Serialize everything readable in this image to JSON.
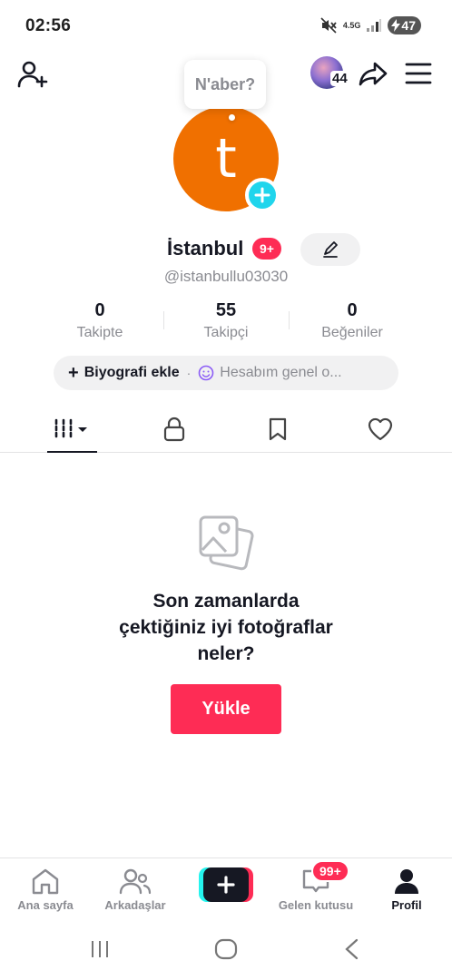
{
  "status_bar": {
    "time": "02:56",
    "network": "4.5G",
    "battery": "47"
  },
  "top_bar": {
    "visitor_count": "44"
  },
  "bubble": {
    "text": "N'aber?"
  },
  "avatar": {
    "letter": "t",
    "color": "#f07000"
  },
  "profile": {
    "name": "İstanbul",
    "badge": "9+",
    "handle": "@istanbullu03030"
  },
  "stats": [
    {
      "value": "0",
      "label": "Takipte"
    },
    {
      "value": "55",
      "label": "Takipçi"
    },
    {
      "value": "0",
      "label": "Beğeniler"
    }
  ],
  "bio": {
    "add_label": "Biyografi ekle",
    "separator": "·",
    "account_label": "Hesabım genel o..."
  },
  "tabs": [
    {
      "icon": "grid-icon",
      "active": true
    },
    {
      "icon": "lock-icon",
      "active": false
    },
    {
      "icon": "bookmark-icon",
      "active": false
    },
    {
      "icon": "heart-icon",
      "active": false
    }
  ],
  "empty_state": {
    "line1": "Son zamanlarda",
    "line2": "çektiğiniz iyi fotoğraflar",
    "line3": "neler?",
    "button": "Yükle"
  },
  "bottom_nav": {
    "home": "Ana sayfa",
    "friends": "Arkadaşlar",
    "inbox": "Gelen kutusu",
    "inbox_badge": "99+",
    "profile": "Profil"
  },
  "colors": {
    "accent": "#fe2c55",
    "cyan": "#20d5ec",
    "text": "#161823",
    "muted": "#8a8b91"
  }
}
